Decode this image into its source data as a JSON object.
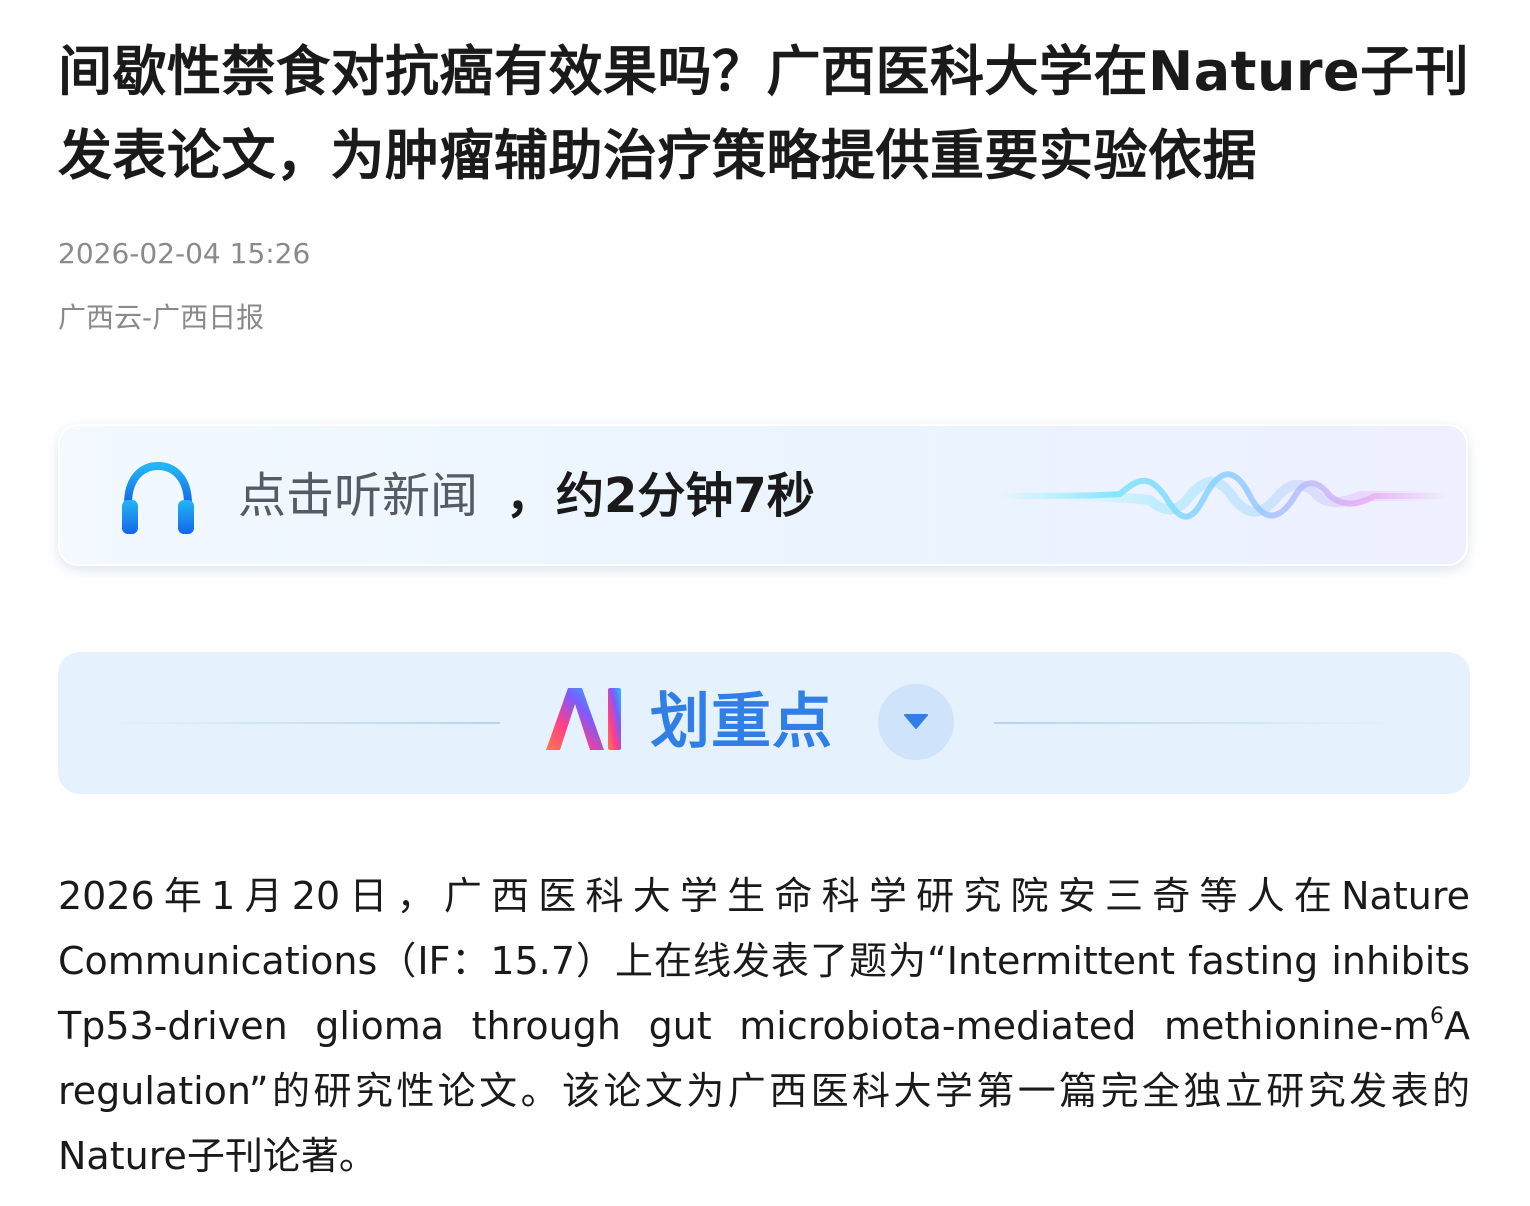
{
  "article": {
    "title": "间歇性禁食对抗癌有效果吗？广西医科大学在Nature子刊发表论文，为肿瘤辅助治疗策略提供重要实验依据",
    "publish_time": "2026-02-04 15:26",
    "source": "广西云-广西日报"
  },
  "listen": {
    "icon": "headphones-icon",
    "label": "点击听新闻",
    "separator": "，",
    "duration": "约2分钟7秒",
    "wave_icon": "audio-wave-icon"
  },
  "ai_summary": {
    "logo": "AI",
    "label": "划重点",
    "toggle_icon": "chevron-down-icon"
  },
  "body": {
    "p1_before_sup": "2026年1月20日，广西医科大学生命科学研究院安三奇等人在Nature Communications（IF：15.7）上在线发表了题为“Intermittent fasting inhibits Tp53-driven glioma through gut microbiota-mediated methionine-m",
    "p1_sup": "6",
    "p1_after_sup": "A regulation”的研究性论文。该论文为广西医科大学第一篇完全独立研究发表的Nature子刊论著。"
  },
  "colors": {
    "title": "#1a1a1a",
    "meta": "#8a8a8a",
    "ai_blue": "#2f7fe6",
    "ai_card_bg": "#e6f1fe",
    "headphone_blue": "#1a7cf0"
  }
}
